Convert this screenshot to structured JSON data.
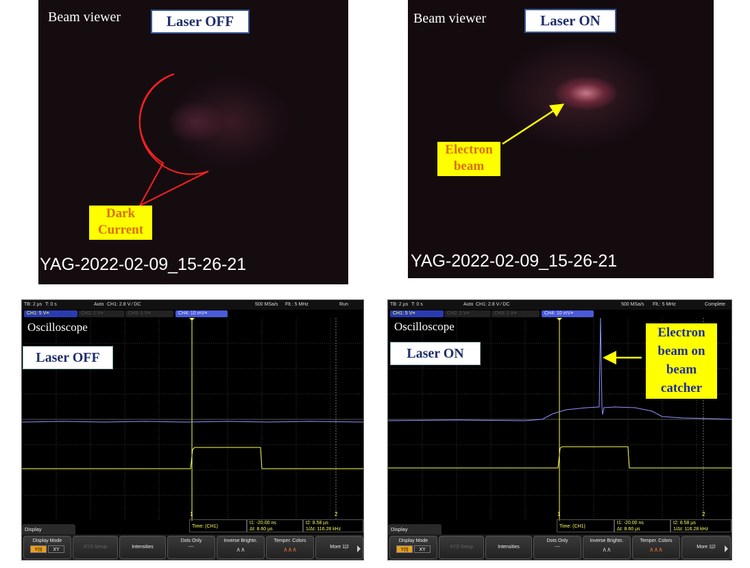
{
  "camera_off": {
    "title": "Beam viewer",
    "state": "Laser OFF",
    "callout_line1": "Dark",
    "callout_line2": "Current",
    "timestamp": "YAG-2022-02-09_15-26-21"
  },
  "camera_on": {
    "title": "Beam viewer",
    "state": "Laser ON",
    "callout_line1": "Electron",
    "callout_line2": "beam",
    "timestamp": "YAG-2022-02-09_15-26-21"
  },
  "osc_off": {
    "status": {
      "tb": "TB: 2 µs",
      "t": "T: 0 s",
      "mode": "Auto",
      "trig": "CH1: 2.8 V ⁄ DC",
      "rate": "500 MSa/s",
      "filter": "Flt.: 5 MHz",
      "run": "Run"
    },
    "channels": {
      "ch1": "CH1: 5 V≡",
      "ch2": "CH2: 1 V≡",
      "ch3": "CH3: 1 V≡",
      "ch4": "CH4: 10 mV≡"
    },
    "label": "Oscilloscope",
    "state": "Laser OFF",
    "measurements": {
      "time": "Time:  (CH1)",
      "t1": "t1: -20.00 ns",
      "dt": "Δt: 8.60 µs",
      "t2": "t2: 8.58 µs",
      "inv": "1/Δt: 116.28 kHz"
    },
    "display_tab": "Display",
    "menu": {
      "display_mode": "Display Mode",
      "yt": "Y(t)",
      "xy": "XY",
      "xyz": "XYZ-Setup",
      "intensities": "Intensities",
      "dots": "Dots Only",
      "inverse": "Inverse Brightn.",
      "temper": "Temper. Colors",
      "more": "More 1|2"
    },
    "markers": {
      "one": "1",
      "two": "2"
    }
  },
  "osc_on": {
    "status": {
      "tb": "TB: 2 µs",
      "t": "T: 0 s",
      "mode": "Auto",
      "trig": "CH1: 2.8 V ⁄ DC",
      "rate": "500 MSa/s",
      "filter": "Flt.: 5 MHz",
      "run": "Complete"
    },
    "channels": {
      "ch1": "CH1: 5 V≡",
      "ch2": "CH2: 1 V≡",
      "ch3": "CH3: 1 V≡",
      "ch4": "CH4: 10 mV≡"
    },
    "label": "Oscilloscope",
    "state": "Laser ON",
    "callout": [
      "Electron",
      "beam on",
      "beam",
      "catcher"
    ],
    "measurements": {
      "time": "Time:  (CH1)",
      "t1": "t1: -20.00 ns",
      "dt": "Δt: 8.60 µs",
      "t2": "t2: 8.58 µs",
      "inv": "1/Δt: 116.28 kHz"
    },
    "display_tab": "Display",
    "menu": {
      "display_mode": "Display Mode",
      "yt": "Y(t)",
      "xy": "XY",
      "xyz": "XYZ-Setup",
      "intensities": "Intensities",
      "dots": "Dots Only",
      "inverse": "Inverse Brightn.",
      "temper": "Temper. Colors",
      "more": "More 1|2"
    },
    "markers": {
      "one": "1",
      "two": "2"
    }
  },
  "colors": {
    "ch1": "#ffff55",
    "ch4": "#8f96ff",
    "callout_bg": "#ffff00",
    "callout_red": "#ff2020"
  }
}
